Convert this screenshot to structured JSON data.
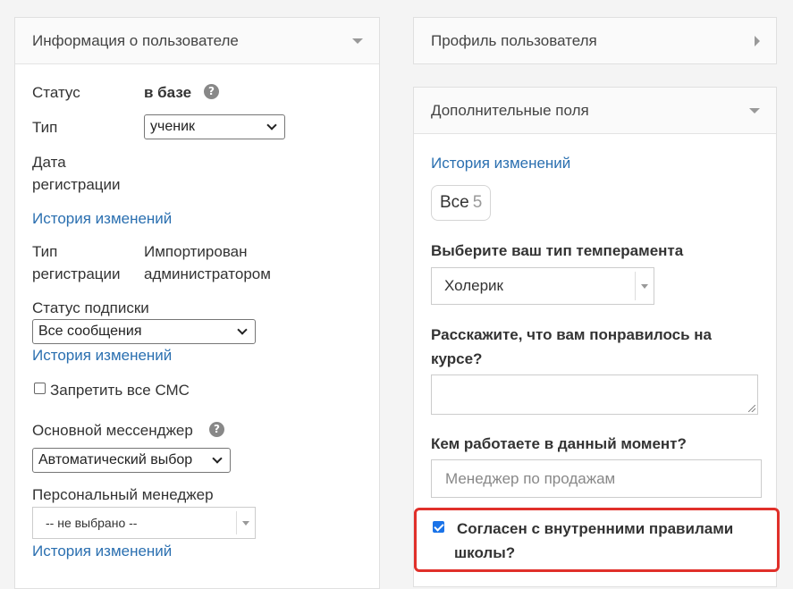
{
  "user_info": {
    "title": "Информация о пользователе",
    "status_label": "Статус",
    "status_value": "в базе",
    "type_label": "Тип",
    "type_value": "ученик",
    "reg_date_label_1": "Дата",
    "reg_date_label_2": "регистрации",
    "history_link": "История изменений",
    "reg_type_label_1": "Тип",
    "reg_type_label_2": "регистрации",
    "reg_type_value_1": "Импортирован",
    "reg_type_value_2": "администратором",
    "subscription_label": "Статус подписки",
    "subscription_value": "Все сообщения",
    "sms_label": "Запретить все СМС",
    "messenger_label": "Основной мессенджер",
    "messenger_value": "Автоматический выбор",
    "manager_label": "Персональный менеджер",
    "manager_value": "-- не выбрано --"
  },
  "profile": {
    "title": "Профиль пользователя"
  },
  "extra": {
    "title": "Дополнительные поля",
    "history_link": "История изменений",
    "filter_label": "Все",
    "filter_count": "5",
    "temperament_label": "Выберите ваш тип темперамента",
    "temperament_value": "Холерик",
    "liked_label_1": "Расскажите, что вам понравилось на",
    "liked_label_2": "курсе?",
    "job_label": "Кем работаете в данный момент?",
    "job_placeholder": "Менеджер по продажам",
    "agree_label_1": "Согласен с внутренними правилами",
    "agree_label_2": "школы?"
  },
  "colors": {
    "link": "#2a6fb0",
    "highlight": "#e0302a",
    "checkbox": "#1a73e8"
  }
}
